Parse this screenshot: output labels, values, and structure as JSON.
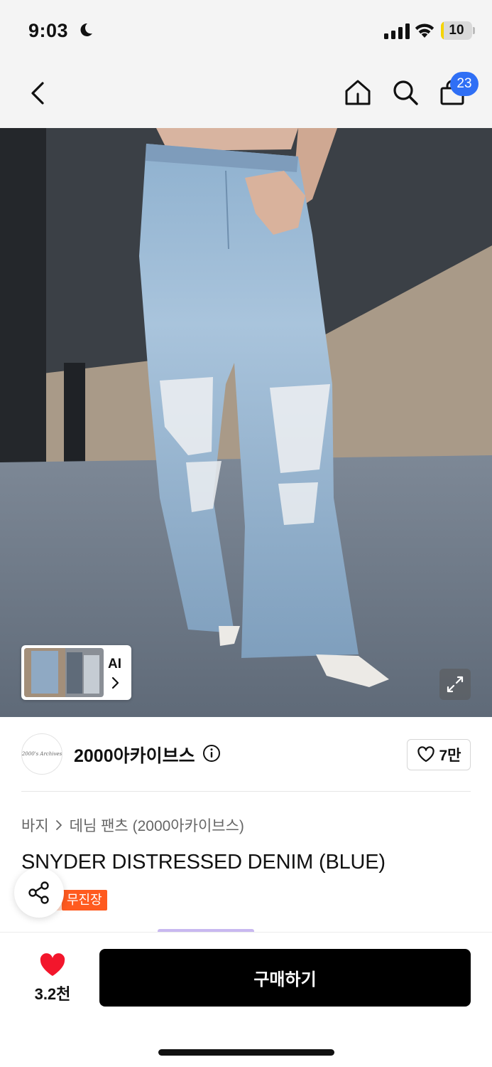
{
  "status_bar": {
    "time": "9:03",
    "battery": "10",
    "battery_level": 0.1
  },
  "nav": {
    "cart_count": "23"
  },
  "gallery": {
    "ai_label": "AI"
  },
  "brand": {
    "name": "2000아카이브스",
    "logo_text": "2000's Archives",
    "likes": "7만"
  },
  "breadcrumb": [
    "바지",
    "데님 팬츠 (2000아카이브스)"
  ],
  "product": {
    "title": "SNYDER DISTRESSED DENIM (BLUE)",
    "tag": "무진장"
  },
  "bottom_bar": {
    "favorites": "3.2천",
    "buy_label": "구매하기"
  },
  "colors": {
    "accent_blue": "#2f6ff5",
    "tag_orange": "#ff5a1f",
    "heart_red": "#f3162c",
    "buy_button": "#000000"
  },
  "icons": [
    "moon-icon",
    "signal-icon",
    "wifi-icon",
    "back-icon",
    "home-icon",
    "search-icon",
    "shopping-bag-icon",
    "chevron-right-icon",
    "expand-icon",
    "info-icon",
    "heart-outline-icon",
    "share-icon",
    "heart-filled-icon"
  ]
}
